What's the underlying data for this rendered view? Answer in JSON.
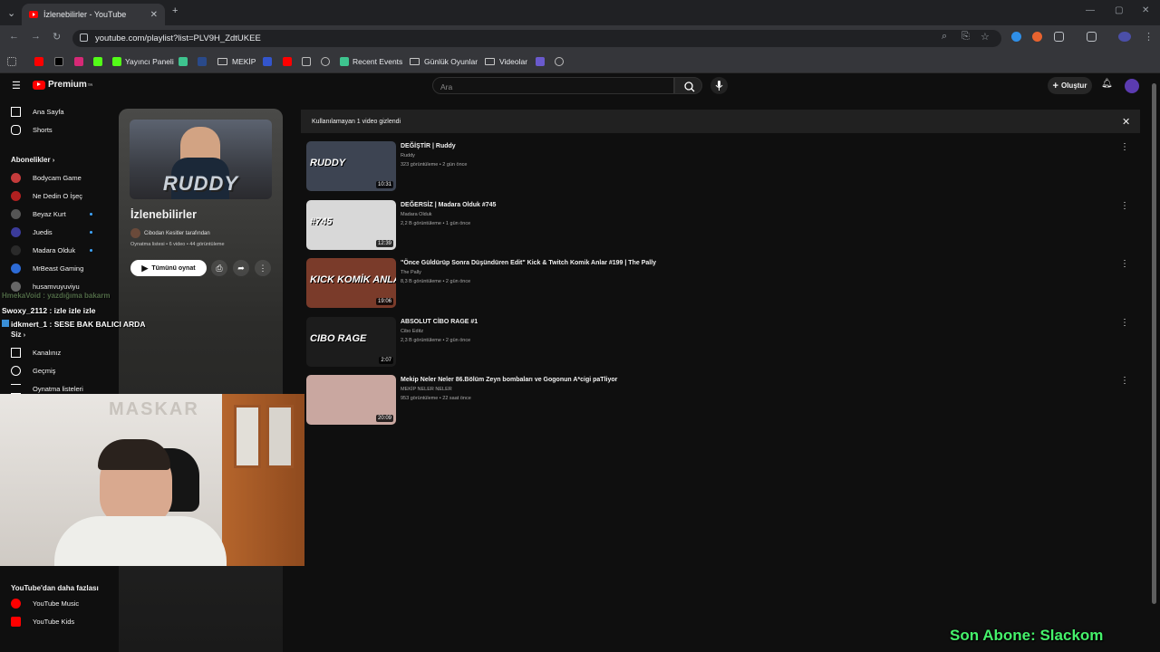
{
  "browser": {
    "tab_title": "İzlenebilirler - YouTube",
    "tab_close": "✕",
    "new_tab": "+",
    "url": "youtube.com/playlist?list=PLV9H_ZdtUKEE",
    "bookmarks": [
      {
        "label": "Yayıncı Paneli"
      },
      {
        "label": "MEKİP"
      },
      {
        "label": "Recent Events"
      },
      {
        "label": "Günlük Oyunlar"
      },
      {
        "label": "Videolar"
      }
    ]
  },
  "header": {
    "logo_text": "Premium",
    "logo_badge": "TR",
    "search_placeholder": "Ara",
    "create_label": "Oluştur"
  },
  "sidebar": {
    "home": "Ana Sayfa",
    "shorts": "Shorts",
    "subscriptions_title": "Abonelikler",
    "subscriptions": [
      {
        "name": "Bodycam Game",
        "color": "#c43b3b",
        "dot": false
      },
      {
        "name": "Ne Dedin O İşeç",
        "color": "#b02020",
        "dot": false
      },
      {
        "name": "Beyaz Kurt",
        "color": "#555555",
        "dot": true
      },
      {
        "name": "Juedis",
        "color": "#3b3b9a",
        "dot": true
      },
      {
        "name": "Madara Olduk",
        "color": "#2a2a2a",
        "dot": true
      },
      {
        "name": "MrBeast Gaming",
        "color": "#2d6bd6",
        "dot": false
      },
      {
        "name": "husamvuyuviyu",
        "color": "#666666",
        "dot": false
      }
    ],
    "you_title": "Siz",
    "you_items": [
      "Kanalınız",
      "Geçmiş",
      "Oynatma listeleri"
    ],
    "more_title": "YouTube'dan daha fazlası",
    "more_items": [
      "YouTube Music",
      "YouTube Kids"
    ]
  },
  "playlist": {
    "thumb_text": "RUDDY",
    "title": "İzlenebilirler",
    "owner": "Cibodan Kesitler tarafından",
    "meta": "Oynatma listesi • 6 video • 44 görüntüleme",
    "play_all": "Tümünü oynat"
  },
  "banner": {
    "text": "Kullanılamayan 1 video gizlendi"
  },
  "videos": [
    {
      "title": "DEĞİŞTİR | Ruddy",
      "channel": "Ruddy",
      "meta": "323 görüntüleme • 2 gün önce",
      "duration": "10:31",
      "thumb_text": "RUDDY",
      "bg": "#3d4452"
    },
    {
      "title": "DEĞERSİZ | Madara Olduk #745",
      "channel": "Madara Olduk",
      "meta": "2,2 B görüntüleme • 1 gün önce",
      "duration": "12:39",
      "thumb_text": "#745",
      "bg": "#d8d8d8"
    },
    {
      "title": "\"Önce Güldürüp Sonra Düşündüren Edit\" Kick & Twitch Komik Anlar #199 | The Pally",
      "channel": "The Pally",
      "meta": "8,3 B görüntüleme • 2 gün önce",
      "duration": "19:06",
      "thumb_text": "KICK KOMİK ANLAR",
      "bg": "#7a3b2a"
    },
    {
      "title": "ABSOLUT CİBO RAGE #1",
      "channel": "Cibo Editz",
      "meta": "2,3 B görüntüleme • 2 gün önce",
      "duration": "2:07",
      "thumb_text": "CIBO RAGE",
      "bg": "#1c1c1c"
    },
    {
      "title": "Mekip Neler Neler 86.Bölüm Zeyn bombaları ve Gogonun A*cigi paTliyor",
      "channel": "MEKİP NELER NELER",
      "meta": "953 görüntüleme • 22 saat önce",
      "duration": "20:09",
      "thumb_text": "",
      "bg": "#c9a7a0"
    }
  ],
  "overlay": {
    "chat_faded": "HmekaVoid : yazdığıma bakarm",
    "chat_1": "Swoxy_2112 : izle izle izle",
    "chat_2": "idkmert_1 : SESE BAK BALICI ARDA",
    "webcam_poster": "MASKAR",
    "last_sub": "Son Abone: Slackom"
  }
}
